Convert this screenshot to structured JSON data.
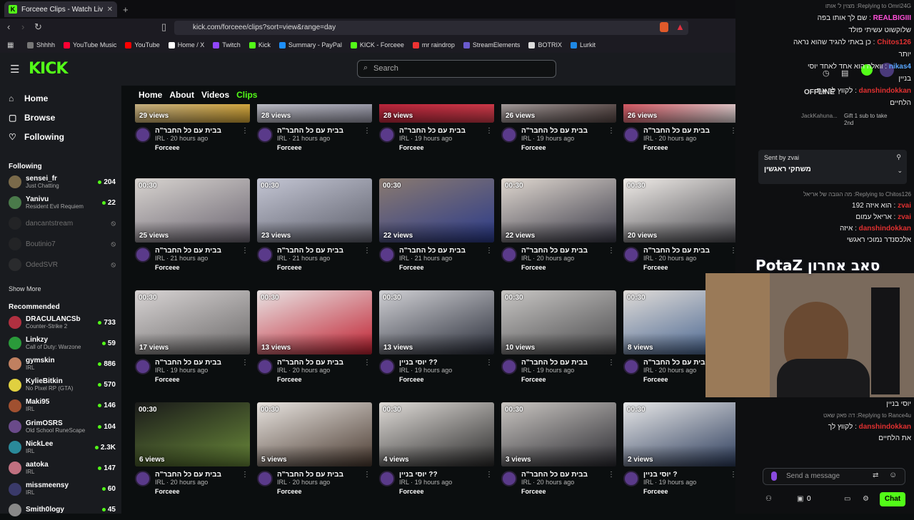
{
  "browser": {
    "tab_title": "Forceee Clips - Watch Live on Ki",
    "url": "kick.com/forceee/clips?sort=view&range=day",
    "bookmarks": [
      {
        "label": "Shhhh",
        "color": "#777"
      },
      {
        "label": "YouTube Music",
        "color": "#ff0033"
      },
      {
        "label": "YouTube",
        "color": "#ff0000"
      },
      {
        "label": "Home / X",
        "color": "#fff"
      },
      {
        "label": "Twitch",
        "color": "#9146ff"
      },
      {
        "label": "Kick",
        "color": "#53fc18"
      },
      {
        "label": "Summary - PayPal",
        "color": "#1e90ff"
      },
      {
        "label": "KICK - Forceee",
        "color": "#53fc18"
      },
      {
        "label": "mr raindrop",
        "color": "#e33"
      },
      {
        "label": "StreamElements",
        "color": "#6a5acd"
      },
      {
        "label": "BOTRIX",
        "color": "#ddd"
      },
      {
        "label": "Lurkit",
        "color": "#1e88e5"
      }
    ]
  },
  "header": {
    "logo": "KICK",
    "search_placeholder": "Search"
  },
  "sidebar": {
    "nav": [
      {
        "label": "Home",
        "icon": "home-icon"
      },
      {
        "label": "Browse",
        "icon": "browse-icon"
      },
      {
        "label": "Following",
        "icon": "heart-icon"
      }
    ],
    "following_title": "Following",
    "following": [
      {
        "name": "sensei_fr",
        "cat": "Just Chatting",
        "viewers": "204",
        "online": true,
        "color": "#7a6a4a"
      },
      {
        "name": "Yanivu",
        "cat": "Resident Evil Requiem",
        "viewers": "22",
        "online": true,
        "color": "#4a7a4a"
      },
      {
        "name": "dancantstream",
        "cat": "",
        "viewers": "",
        "online": false,
        "color": "#333"
      },
      {
        "name": "Boutinio7",
        "cat": "",
        "viewers": "",
        "online": false,
        "color": "#333"
      },
      {
        "name": "OdedSVR",
        "cat": "",
        "viewers": "",
        "online": false,
        "color": "#444"
      }
    ],
    "show_more": "Show More",
    "recommended_title": "Recommended",
    "recommended": [
      {
        "name": "DRACULANCSb",
        "cat": "Counter-Strike 2",
        "viewers": "733",
        "color": "#b03040"
      },
      {
        "name": "Linkzy",
        "cat": "Call of Duty: Warzone",
        "viewers": "59",
        "color": "#2a9a3a"
      },
      {
        "name": "gymskin",
        "cat": "IRL",
        "viewers": "886",
        "color": "#c08060"
      },
      {
        "name": "KylieBitkin",
        "cat": "No Pixel RP (GTA)",
        "viewers": "570",
        "color": "#e0d040"
      },
      {
        "name": "Maki95",
        "cat": "IRL",
        "viewers": "146",
        "color": "#a05030"
      },
      {
        "name": "GrimOSRS",
        "cat": "Old School RuneScape",
        "viewers": "104",
        "color": "#6a4a8a"
      },
      {
        "name": "NickLee",
        "cat": "IRL",
        "viewers": "2.3K",
        "color": "#2a8a9a"
      },
      {
        "name": "aatoka",
        "cat": "IRL",
        "viewers": "147",
        "color": "#c07080"
      },
      {
        "name": "missmeensy",
        "cat": "IRL",
        "viewers": "60",
        "color": "#3a3a6a"
      },
      {
        "name": "Smith0logy",
        "cat": "",
        "viewers": "45",
        "color": "#888"
      }
    ]
  },
  "channel_tabs": [
    {
      "label": "Home"
    },
    {
      "label": "About"
    },
    {
      "label": "Videos"
    },
    {
      "label": "Clips",
      "active": true
    }
  ],
  "clips": [
    {
      "dur": "",
      "views": "29 views",
      "title": "בבית עם כל החבר\"ה",
      "cat": "IRL",
      "age": "20 hours ago",
      "channel": "Forceee",
      "bg": "linear-gradient(135deg,#cfc2a8,#e5b23a)"
    },
    {
      "dur": "",
      "views": "28 views",
      "title": "בבית עם כל החבר\"ה",
      "cat": "IRL",
      "age": "21 hours ago",
      "channel": "Forceee",
      "bg": "linear-gradient(135deg,#d8d8e0,#a0a0b0)"
    },
    {
      "dur": "",
      "views": "28 views",
      "title": "בבית עם כל החבר\"ה",
      "cat": "IRL",
      "age": "19 hours ago",
      "channel": "Forceee",
      "bg": "linear-gradient(135deg,#c0203a,#e04050)"
    },
    {
      "dur": "",
      "views": "26 views",
      "title": "בבית עם כל החבר\"ה",
      "cat": "IRL",
      "age": "19 hours ago",
      "channel": "Forceee",
      "bg": "linear-gradient(135deg,#d0c8c8,#5a4a48)"
    },
    {
      "dur": "",
      "views": "26 views",
      "title": "בבית עם כל החבר\"ה",
      "cat": "IRL",
      "age": "20 hours ago",
      "channel": "Forceee",
      "bg": "linear-gradient(135deg,#e03040,#f0e8e8)"
    },
    {
      "dur": "00:30",
      "views": "25 views",
      "title": "בבית עם כל החבר\"ה",
      "cat": "IRL",
      "age": "21 hours ago",
      "channel": "Forceee",
      "bg": "linear-gradient(160deg,#d8d4d0,#6a6470)"
    },
    {
      "dur": "00:30",
      "views": "23 views",
      "title": "בבית עם כל החבר\"ה",
      "cat": "IRL",
      "age": "21 hours ago",
      "channel": "Forceee",
      "bg": "linear-gradient(160deg,#c4c6d4,#5c5e6a)"
    },
    {
      "dur": "00:30",
      "views": "22 views",
      "title": "בבית עם כל החבר\"ה",
      "cat": "IRL",
      "age": "21 hours ago",
      "channel": "Forceee",
      "bg": "linear-gradient(160deg,#8a7a70,#2a3a8a)"
    },
    {
      "dur": "00:30",
      "views": "22 views",
      "title": "בבית עם כל החבר\"ה",
      "cat": "IRL",
      "age": "20 hours ago",
      "channel": "Forceee",
      "bg": "linear-gradient(160deg,#e0d8d0,#3a3a48)"
    },
    {
      "dur": "00:30",
      "views": "20 views",
      "title": "בבית עם כל החבר\"ה",
      "cat": "IRL",
      "age": "20 hours ago",
      "channel": "Forceee",
      "bg": "linear-gradient(160deg,#f0ece8,#4a4a50)"
    },
    {
      "dur": "00:30",
      "views": "17 views",
      "title": "בבית עם כל החבר\"ה",
      "cat": "IRL",
      "age": "19 hours ago",
      "channel": "Forceee",
      "bg": "linear-gradient(160deg,#d8d4d4,#6a6868)"
    },
    {
      "dur": "00:30",
      "views": "13 views",
      "title": "בבית עם כל החבר\"ה",
      "cat": "IRL",
      "age": "20 hours ago",
      "channel": "Forceee",
      "bg": "linear-gradient(160deg,#e8e4e4,#c02030)"
    },
    {
      "dur": "00:30",
      "views": "13 views",
      "title": "?? יוסי בניין",
      "cat": "IRL",
      "age": "19 hours ago",
      "channel": "Forceee",
      "bg": "linear-gradient(160deg,#d0d0d4,#2a2e3a)"
    },
    {
      "dur": "00:30",
      "views": "10 views",
      "title": "בבית עם כל החבר\"ה",
      "cat": "IRL",
      "age": "19 hours ago",
      "channel": "Forceee",
      "bg": "linear-gradient(160deg,#c8c6c4,#4a4a4c)"
    },
    {
      "dur": "00:30",
      "views": "8 views",
      "title": "בבית עם כל החבר\"ה",
      "cat": "IRL",
      "age": "20 hours ago",
      "channel": "Forceee",
      "bg": "linear-gradient(160deg,#e0dcd8,#3a5a8a)"
    },
    {
      "dur": "00:30",
      "views": "6 views",
      "title": "בבית עם כל החבר\"ה",
      "cat": "IRL",
      "age": "20 hours ago",
      "channel": "Forceee",
      "bg": "linear-gradient(160deg,#1a1a1a,#6a8a3a)"
    },
    {
      "dur": "00:30",
      "views": "5 views",
      "title": "בבית עם כל החבר\"ה",
      "cat": "IRL",
      "age": "20 hours ago",
      "channel": "Forceee",
      "bg": "linear-gradient(160deg,#e8e4e0,#4a3a30)"
    },
    {
      "dur": "00:30",
      "views": "4 views",
      "title": "?? יוסי בניין",
      "cat": "IRL",
      "age": "19 hours ago",
      "channel": "Forceee",
      "bg": "linear-gradient(160deg,#e0dcd8,#2a2a2a)"
    },
    {
      "dur": "00:30",
      "views": "3 views",
      "title": "בבית עם כל החבר\"ה",
      "cat": "IRL",
      "age": "20 hours ago",
      "channel": "Forceee",
      "bg": "linear-gradient(160deg,#cac6c2,#2a2a30)"
    },
    {
      "dur": "00:30",
      "views": "2 views",
      "title": "? יוסי בניין",
      "cat": "IRL",
      "age": "19 hours ago",
      "channel": "Forceee",
      "bg": "linear-gradient(160deg,#e8e8e8,#2a3a5a)"
    }
  ],
  "chat": {
    "lines": [
      {
        "text": "Replying to Omri24G: מצוין ל' אותו",
        "rep": true
      },
      {
        "text": "REALBIGIII: שם לך אותו בפה",
        "user": "REALBIGIII",
        "ucolor": "#ff4fd8"
      },
      {
        "text": "שלוקשוט עשיתי פולד"
      },
      {
        "text": "Chitos126: כן באתי להגיד שהוא נראה",
        "user": "Chitos126",
        "ucolor": "#e03030"
      },
      {
        "text": "יותר"
      },
      {
        "text": "nikas4: וואלה הוא אחד לאחד יוסי",
        "user": "nikas4",
        "ucolor": "#58a6ff"
      },
      {
        "text": "בניין"
      },
      {
        "text": "danshindokkan: לקווץ לך את",
        "user": "danshindokkan",
        "ucolor": "#e03030"
      },
      {
        "text": "הלחיים"
      }
    ],
    "offline": "OFFLINE",
    "gift_text": "Gift 1 sub to take 2nd",
    "gift_user": "JackKahuna...",
    "pinned_sender": "Sent by zvai",
    "pinned_text": "משחקי ראגשין",
    "lines2": [
      {
        "text": "Replying to Chitos126: מה הגובה של אריאל",
        "rep": true
      },
      {
        "text": "zvai: הוא איזה 192",
        "user": "zvai",
        "ucolor": "#e03030"
      },
      {
        "text": "zvai: אריאל עמום",
        "user": "zvai",
        "ucolor": "#e03030"
      },
      {
        "text": "danshindokkan: איזה",
        "user": "danshindokkan",
        "ucolor": "#e03030"
      },
      {
        "text": "אלכסנדר נמוכי ראגשי"
      }
    ],
    "overlay": "PotaZ סאב אחרון",
    "lines3": [
      {
        "text": "יוסי בניין"
      },
      {
        "text": "Replying to Rance4u: דה פאק שאט",
        "rep": true
      },
      {
        "text": "danshindokkan: לקווץ לך",
        "user": "danshindokkan",
        "ucolor": "#e03030"
      },
      {
        "text": "את הלחיים"
      }
    ],
    "send_placeholder": "Send a message",
    "chat_button": "Chat",
    "counter": "0"
  }
}
